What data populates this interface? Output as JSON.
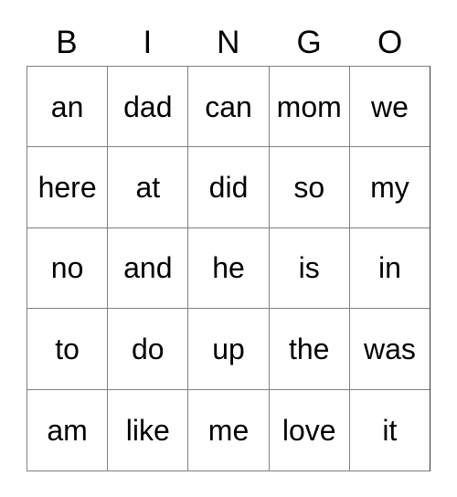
{
  "card": {
    "title": "BINGO",
    "headers": [
      "B",
      "I",
      "N",
      "G",
      "O"
    ],
    "rows": [
      {
        "cells": [
          "an",
          "dad",
          "can",
          "mom",
          "we"
        ]
      },
      {
        "cells": [
          "here",
          "at",
          "did",
          "so",
          "my"
        ]
      },
      {
        "cells": [
          "no",
          "and",
          "he",
          "is",
          "in"
        ]
      },
      {
        "cells": [
          "to",
          "do",
          "up",
          "the",
          "was"
        ]
      },
      {
        "cells": [
          "am",
          "like",
          "me",
          "love",
          "it"
        ]
      }
    ],
    "colors": {
      "text": "#000000",
      "background": "#ffffff",
      "grid_line": "#808080",
      "outer_line": "#3a3a3a"
    }
  }
}
